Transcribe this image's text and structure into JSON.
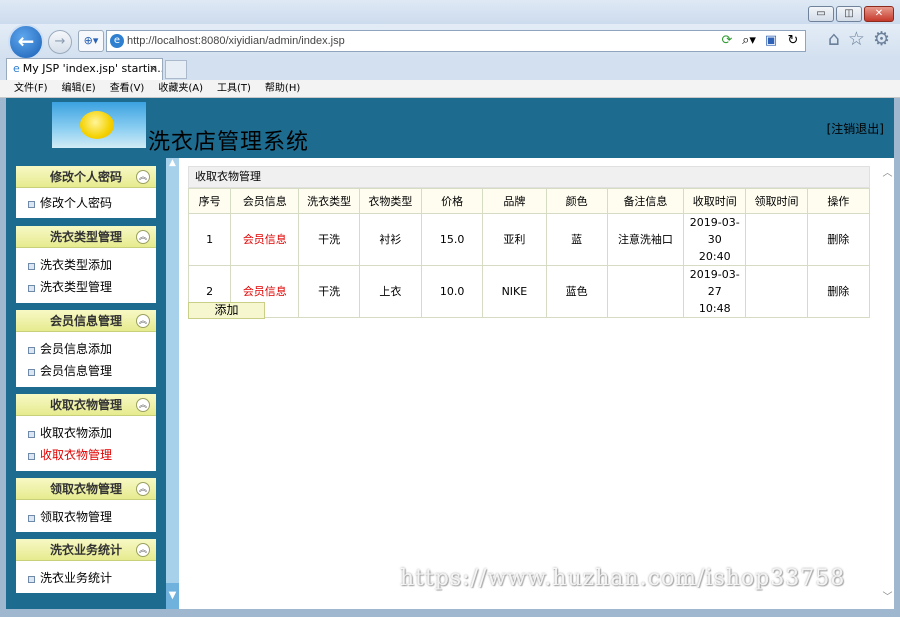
{
  "browser": {
    "window_buttons": [
      "▭",
      "◫",
      "✕"
    ],
    "back_glyph": "←",
    "forward_glyph": "→",
    "compat_glyph": "⊕▾",
    "url": "http://localhost:8080/xiyidian/admin/index.jsp",
    "address_icons": [
      "⟳",
      "⌕▾",
      "▣",
      "↻"
    ],
    "right_icons": [
      "⌂",
      "☆",
      "⚙"
    ],
    "tab_title": "My JSP 'index.jsp' startin...",
    "tab_close": "×",
    "menu": [
      "文件(F)",
      "编辑(E)",
      "查看(V)",
      "收藏夹(A)",
      "工具(T)",
      "帮助(H)"
    ]
  },
  "app": {
    "title": "洗衣店管理系统",
    "logout": "[注销退出]"
  },
  "sidebar": {
    "collapse_glyph": "︽",
    "groups": [
      {
        "title": "修改个人密码",
        "items": [
          "修改个人密码"
        ]
      },
      {
        "title": "洗衣类型管理",
        "items": [
          "洗衣类型添加",
          "洗衣类型管理"
        ]
      },
      {
        "title": "会员信息管理",
        "items": [
          "会员信息添加",
          "会员信息管理"
        ]
      },
      {
        "title": "收取衣物管理",
        "items": [
          "收取衣物添加",
          "收取衣物管理"
        ]
      },
      {
        "title": "领取衣物管理",
        "items": [
          "领取衣物管理"
        ]
      },
      {
        "title": "洗衣业务统计",
        "items": [
          "洗衣业务统计"
        ]
      }
    ],
    "active_item": "收取衣物管理"
  },
  "main": {
    "panel_title": "收取衣物管理",
    "columns": [
      "序号",
      "会员信息",
      "洗衣类型",
      "衣物类型",
      "价格",
      "品牌",
      "颜色",
      "备注信息",
      "收取时间",
      "领取时间",
      "操作"
    ],
    "rows": [
      {
        "no": "1",
        "member": "会员信息",
        "wash_type": "干洗",
        "cloth_type": "衬衫",
        "price": "15.0",
        "brand": "亚利",
        "color": "蓝",
        "remark": "注意洗袖口",
        "recv_date": "2019-03-30",
        "recv_time": "20:40",
        "pickup": "",
        "action": "删除"
      },
      {
        "no": "2",
        "member": "会员信息",
        "wash_type": "干洗",
        "cloth_type": "上衣",
        "price": "10.0",
        "brand": "NIKE",
        "color": "蓝色",
        "remark": "",
        "recv_date": "2019-03-27",
        "recv_time": "10:48",
        "pickup": "",
        "action": "删除"
      }
    ],
    "add_button": "添加"
  },
  "scroll": {
    "up": "▲",
    "down": "▼",
    "right_up": "︿",
    "right_down": "﹀"
  },
  "watermark": "https://www.huzhan.com/ishop33758"
}
